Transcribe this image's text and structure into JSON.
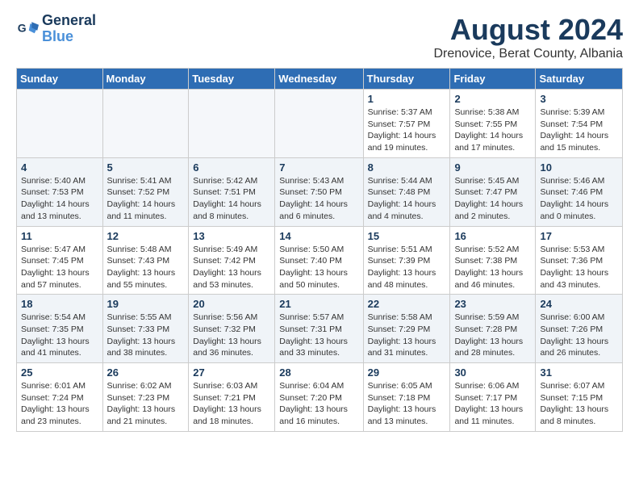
{
  "logo": {
    "line1": "General",
    "line2": "Blue"
  },
  "title": "August 2024",
  "subtitle": "Drenovice, Berat County, Albania",
  "weekdays": [
    "Sunday",
    "Monday",
    "Tuesday",
    "Wednesday",
    "Thursday",
    "Friday",
    "Saturday"
  ],
  "weeks": [
    [
      {
        "day": "",
        "info": ""
      },
      {
        "day": "",
        "info": ""
      },
      {
        "day": "",
        "info": ""
      },
      {
        "day": "",
        "info": ""
      },
      {
        "day": "1",
        "info": "Sunrise: 5:37 AM\nSunset: 7:57 PM\nDaylight: 14 hours\nand 19 minutes."
      },
      {
        "day": "2",
        "info": "Sunrise: 5:38 AM\nSunset: 7:55 PM\nDaylight: 14 hours\nand 17 minutes."
      },
      {
        "day": "3",
        "info": "Sunrise: 5:39 AM\nSunset: 7:54 PM\nDaylight: 14 hours\nand 15 minutes."
      }
    ],
    [
      {
        "day": "4",
        "info": "Sunrise: 5:40 AM\nSunset: 7:53 PM\nDaylight: 14 hours\nand 13 minutes."
      },
      {
        "day": "5",
        "info": "Sunrise: 5:41 AM\nSunset: 7:52 PM\nDaylight: 14 hours\nand 11 minutes."
      },
      {
        "day": "6",
        "info": "Sunrise: 5:42 AM\nSunset: 7:51 PM\nDaylight: 14 hours\nand 8 minutes."
      },
      {
        "day": "7",
        "info": "Sunrise: 5:43 AM\nSunset: 7:50 PM\nDaylight: 14 hours\nand 6 minutes."
      },
      {
        "day": "8",
        "info": "Sunrise: 5:44 AM\nSunset: 7:48 PM\nDaylight: 14 hours\nand 4 minutes."
      },
      {
        "day": "9",
        "info": "Sunrise: 5:45 AM\nSunset: 7:47 PM\nDaylight: 14 hours\nand 2 minutes."
      },
      {
        "day": "10",
        "info": "Sunrise: 5:46 AM\nSunset: 7:46 PM\nDaylight: 14 hours\nand 0 minutes."
      }
    ],
    [
      {
        "day": "11",
        "info": "Sunrise: 5:47 AM\nSunset: 7:45 PM\nDaylight: 13 hours\nand 57 minutes."
      },
      {
        "day": "12",
        "info": "Sunrise: 5:48 AM\nSunset: 7:43 PM\nDaylight: 13 hours\nand 55 minutes."
      },
      {
        "day": "13",
        "info": "Sunrise: 5:49 AM\nSunset: 7:42 PM\nDaylight: 13 hours\nand 53 minutes."
      },
      {
        "day": "14",
        "info": "Sunrise: 5:50 AM\nSunset: 7:40 PM\nDaylight: 13 hours\nand 50 minutes."
      },
      {
        "day": "15",
        "info": "Sunrise: 5:51 AM\nSunset: 7:39 PM\nDaylight: 13 hours\nand 48 minutes."
      },
      {
        "day": "16",
        "info": "Sunrise: 5:52 AM\nSunset: 7:38 PM\nDaylight: 13 hours\nand 46 minutes."
      },
      {
        "day": "17",
        "info": "Sunrise: 5:53 AM\nSunset: 7:36 PM\nDaylight: 13 hours\nand 43 minutes."
      }
    ],
    [
      {
        "day": "18",
        "info": "Sunrise: 5:54 AM\nSunset: 7:35 PM\nDaylight: 13 hours\nand 41 minutes."
      },
      {
        "day": "19",
        "info": "Sunrise: 5:55 AM\nSunset: 7:33 PM\nDaylight: 13 hours\nand 38 minutes."
      },
      {
        "day": "20",
        "info": "Sunrise: 5:56 AM\nSunset: 7:32 PM\nDaylight: 13 hours\nand 36 minutes."
      },
      {
        "day": "21",
        "info": "Sunrise: 5:57 AM\nSunset: 7:31 PM\nDaylight: 13 hours\nand 33 minutes."
      },
      {
        "day": "22",
        "info": "Sunrise: 5:58 AM\nSunset: 7:29 PM\nDaylight: 13 hours\nand 31 minutes."
      },
      {
        "day": "23",
        "info": "Sunrise: 5:59 AM\nSunset: 7:28 PM\nDaylight: 13 hours\nand 28 minutes."
      },
      {
        "day": "24",
        "info": "Sunrise: 6:00 AM\nSunset: 7:26 PM\nDaylight: 13 hours\nand 26 minutes."
      }
    ],
    [
      {
        "day": "25",
        "info": "Sunrise: 6:01 AM\nSunset: 7:24 PM\nDaylight: 13 hours\nand 23 minutes."
      },
      {
        "day": "26",
        "info": "Sunrise: 6:02 AM\nSunset: 7:23 PM\nDaylight: 13 hours\nand 21 minutes."
      },
      {
        "day": "27",
        "info": "Sunrise: 6:03 AM\nSunset: 7:21 PM\nDaylight: 13 hours\nand 18 minutes."
      },
      {
        "day": "28",
        "info": "Sunrise: 6:04 AM\nSunset: 7:20 PM\nDaylight: 13 hours\nand 16 minutes."
      },
      {
        "day": "29",
        "info": "Sunrise: 6:05 AM\nSunset: 7:18 PM\nDaylight: 13 hours\nand 13 minutes."
      },
      {
        "day": "30",
        "info": "Sunrise: 6:06 AM\nSunset: 7:17 PM\nDaylight: 13 hours\nand 11 minutes."
      },
      {
        "day": "31",
        "info": "Sunrise: 6:07 AM\nSunset: 7:15 PM\nDaylight: 13 hours\nand 8 minutes."
      }
    ]
  ]
}
